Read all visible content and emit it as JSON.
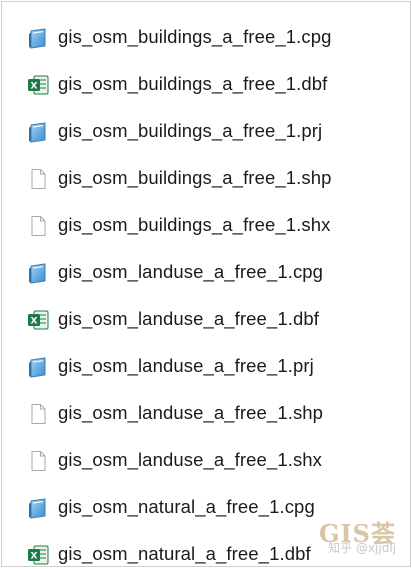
{
  "colors": {
    "excel_green": "#1f7a45",
    "cfg_blue": "#5aa7d9",
    "file_gray": "#b8b8b8",
    "watermark": "#d8c7a6"
  },
  "files": [
    {
      "name": "gis_osm_buildings_a_free_1.cpg",
      "icon": "config-file-icon"
    },
    {
      "name": "gis_osm_buildings_a_free_1.dbf",
      "icon": "excel-file-icon"
    },
    {
      "name": "gis_osm_buildings_a_free_1.prj",
      "icon": "config-file-icon"
    },
    {
      "name": "gis_osm_buildings_a_free_1.shp",
      "icon": "blank-file-icon"
    },
    {
      "name": "gis_osm_buildings_a_free_1.shx",
      "icon": "blank-file-icon"
    },
    {
      "name": "gis_osm_landuse_a_free_1.cpg",
      "icon": "config-file-icon"
    },
    {
      "name": "gis_osm_landuse_a_free_1.dbf",
      "icon": "excel-file-icon"
    },
    {
      "name": "gis_osm_landuse_a_free_1.prj",
      "icon": "config-file-icon"
    },
    {
      "name": "gis_osm_landuse_a_free_1.shp",
      "icon": "blank-file-icon"
    },
    {
      "name": "gis_osm_landuse_a_free_1.shx",
      "icon": "blank-file-icon"
    },
    {
      "name": "gis_osm_natural_a_free_1.cpg",
      "icon": "config-file-icon"
    },
    {
      "name": "gis_osm_natural_a_free_1.dbf",
      "icon": "excel-file-icon"
    }
  ],
  "watermark": {
    "title": "GIS荟",
    "subtitle": "知乎 @xjjdlj"
  }
}
